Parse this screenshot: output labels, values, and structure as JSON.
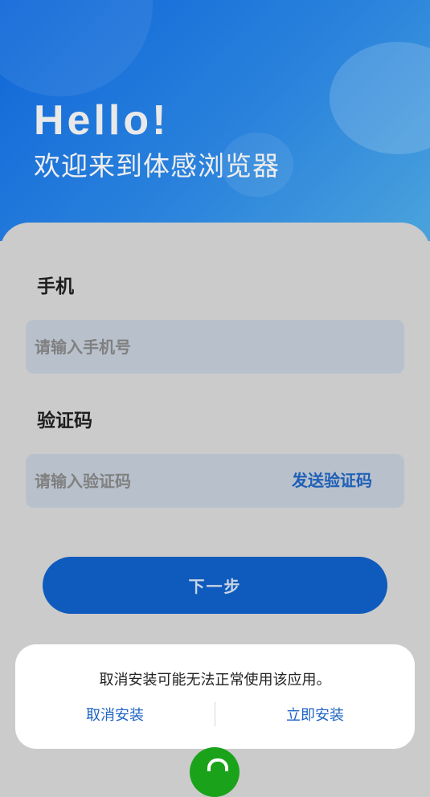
{
  "hero": {
    "greeting": "Hello!",
    "welcome": "欢迎来到体感浏览器"
  },
  "form": {
    "phone": {
      "label": "手机",
      "placeholder": "请输入手机号",
      "value": ""
    },
    "code": {
      "label": "验证码",
      "placeholder": "请输入验证码",
      "value": "",
      "send_label": "发送验证码"
    },
    "next_label": "下一步"
  },
  "dialog": {
    "message": "取消安装可能无法正常使用该应用。",
    "cancel_label": "取消安装",
    "install_label": "立即安装"
  },
  "fab": {
    "icon": "chat-icon"
  },
  "colors": {
    "accent": "#0f5bbd",
    "hero_start": "#0f66d8",
    "hero_end": "#4ba3dc",
    "fab": "#1aa31a",
    "link": "#1e64c4"
  }
}
